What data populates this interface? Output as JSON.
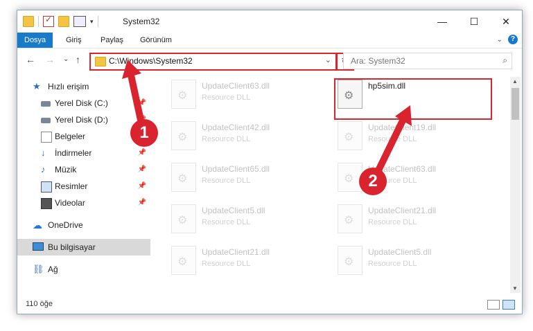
{
  "window": {
    "title": "System32",
    "controls": {
      "minimize": "—",
      "maximize": "☐",
      "close": "✕"
    }
  },
  "ribbon": {
    "tabs": [
      {
        "label": "Dosya",
        "active": true
      },
      {
        "label": "Giriş"
      },
      {
        "label": "Paylaş"
      },
      {
        "label": "Görünüm"
      }
    ],
    "help": "?",
    "expand": "⌄"
  },
  "nav": {
    "back": "←",
    "forward": "→",
    "recent": "⌄",
    "up": "↑",
    "address": "C:\\Windows\\System32",
    "address_dropdown": "⌄",
    "refresh": "↻",
    "search_placeholder": "Ara: System32",
    "search_icon": "⌕"
  },
  "sidebar": {
    "items": [
      {
        "label": "Hızlı erişim",
        "icon": "star-icon"
      },
      {
        "label": "Yerel Disk (C:)",
        "icon": "disk-icon",
        "pinned": true
      },
      {
        "label": "Yerel Disk (D:)",
        "icon": "disk-icon",
        "pinned": true
      },
      {
        "label": "Belgeler",
        "icon": "document-icon",
        "pinned": true
      },
      {
        "label": "İndirmeler",
        "icon": "download-icon",
        "pinned": true
      },
      {
        "label": "Müzik",
        "icon": "music-icon",
        "pinned": true
      },
      {
        "label": "Resimler",
        "icon": "picture-icon",
        "pinned": true
      },
      {
        "label": "Videolar",
        "icon": "video-icon",
        "pinned": true
      },
      {
        "label": "OneDrive",
        "icon": "cloud-icon"
      },
      {
        "label": "Bu bilgisayar",
        "icon": "computer-icon",
        "selected": true
      },
      {
        "label": "Ağ",
        "icon": "network-icon"
      }
    ],
    "pin_glyph": "📌"
  },
  "files": [
    {
      "name": "UpdateClient63.dll",
      "type": "Resource DLL"
    },
    {
      "name": "hp5sim.dll",
      "type": "",
      "highlighted": true
    },
    {
      "name": "UpdateClient42.dll",
      "type": "Resource DLL"
    },
    {
      "name": "UpdateClient19.dll",
      "type": "Resource DLL"
    },
    {
      "name": "UpdateClient65.dll",
      "type": "Resource DLL"
    },
    {
      "name": "UpdateClient63.dll",
      "type": "Resource DLL"
    },
    {
      "name": "UpdateClient5.dll",
      "type": "Resource DLL"
    },
    {
      "name": "UpdateClient21.dll",
      "type": "Resource DLL"
    },
    {
      "name": "UpdateClient21.dll",
      "type": "Resource DLL"
    },
    {
      "name": "UpdateClient5.dll",
      "type": "Resource DLL"
    }
  ],
  "status": {
    "count": "110 öğe"
  },
  "annotations": {
    "step1": "1",
    "step2": "2",
    "color": "#d9232e"
  }
}
